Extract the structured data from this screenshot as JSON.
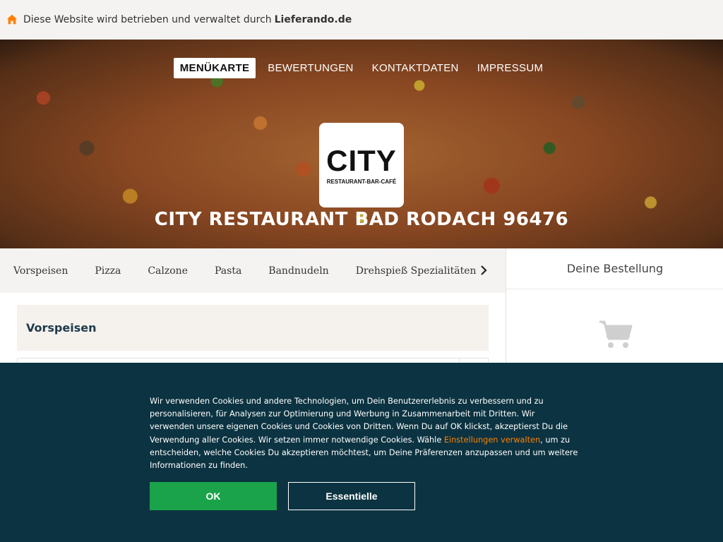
{
  "infobar": {
    "text": "Diese Website wird betrieben und verwaltet durch",
    "brand": "Lieferando.de",
    "icon": "house-icon",
    "icon_color": "#ff8000"
  },
  "hero": {
    "nav": [
      {
        "label": "MENÜKARTE",
        "active": true
      },
      {
        "label": "BEWERTUNGEN",
        "active": false
      },
      {
        "label": "KONTAKTDATEN",
        "active": false
      },
      {
        "label": "IMPRESSUM",
        "active": false
      }
    ],
    "logo": {
      "main": "CITY",
      "sub": "RESTAURANT-BAR-CAFÉ"
    },
    "title": "CITY RESTAURANT BAD RODACH 96476"
  },
  "categories": {
    "items": [
      "Vorspeisen",
      "Pizza",
      "Calzone",
      "Pasta",
      "Bandnudeln",
      "Drehspieß Spezialitäten"
    ],
    "next_icon": "chevron-right-icon"
  },
  "order": {
    "title": "Deine Bestellung",
    "icon": "shopping-cart-icon"
  },
  "menu": {
    "section_title": "Vorspeisen"
  },
  "cookie": {
    "text_before": "Wir verwenden Cookies und andere Technologien, um Dein Benutzererlebnis zu verbessern und zu personalisieren, für Analysen zur Optimierung und Werbung in Zusammenarbeit mit Dritten. Wir verwenden unsere eigenen Cookies und Cookies von Dritten. Wenn Du auf OK klickst, akzeptierst Du die Verwendung aller Cookies. Wir setzen immer notwendige Cookies. Wähle ",
    "link": "Einstellungen verwalten",
    "text_after": ", um zu entscheiden, welche Cookies Du akzeptieren möchtest, um Deine Präferenzen anzupassen und um weitere Informationen zu finden.",
    "ok_label": "OK",
    "essential_label": "Essentielle",
    "colors": {
      "background": "#0c3341",
      "ok": "#1aa34a",
      "link": "#ff8000"
    }
  }
}
